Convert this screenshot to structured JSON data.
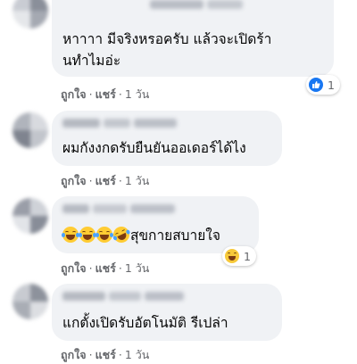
{
  "comments": [
    {
      "text_lines": [
        "หาาาา มีจริงหรอครับ แล้วจะเปิดร้า",
        "นทำไมอ่ะ"
      ],
      "like_label": "ถูกใจ",
      "reply_label": "แชร์",
      "time": "1 วัน",
      "reaction": {
        "icon": "like-icon",
        "count": "1"
      }
    },
    {
      "text_lines": [
        "ผมกังงกดรับยืนยันออเดอร์ได้ไง"
      ],
      "like_label": "ถูกใจ",
      "reply_label": "แชร์",
      "time": "1 วัน"
    },
    {
      "text_lines": [
        "สุขกายสบายใจ"
      ],
      "emoji_prefix": [
        "haha-emoji",
        "haha-emoji",
        "haha-emoji",
        "rofl-emoji"
      ],
      "like_label": "ถูกใจ",
      "reply_label": "แชร์",
      "time": "1 วัน",
      "reaction": {
        "icon": "haha-icon",
        "count": "1"
      }
    },
    {
      "text_lines": [
        "แกตั้งเปิดรับอัตโนมัติ รีเปล่า"
      ],
      "like_label": "ถูกใจ",
      "reply_label": "แชร์",
      "time": "1 วัน"
    }
  ],
  "separator": "·",
  "colors": {
    "bubble": "#f0f2f5",
    "meta_text": "#65676b",
    "like_blue": "#1877f2",
    "haha_yellow": "#f7c93a"
  }
}
